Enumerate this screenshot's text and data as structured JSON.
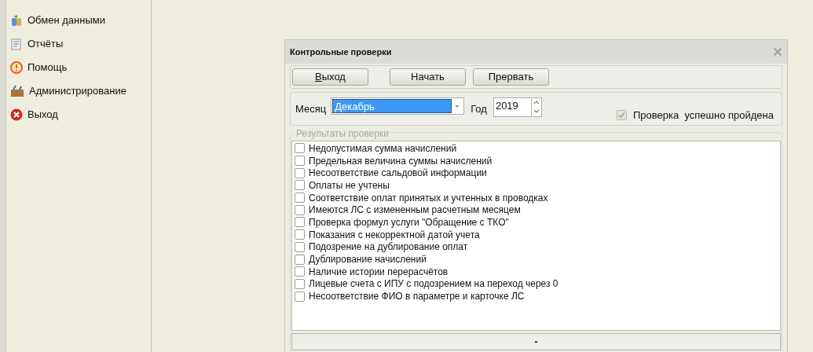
{
  "sidebar": {
    "items": [
      {
        "label": "Обмен данными",
        "kind": "exchange"
      },
      {
        "label": "Отчёты",
        "kind": "reports"
      },
      {
        "label": "Помощь",
        "kind": "help"
      },
      {
        "label": "Администрирование",
        "kind": "admin"
      },
      {
        "label": "Выход",
        "kind": "exit"
      }
    ]
  },
  "dialog": {
    "title": "Контрольные проверки",
    "buttons": [
      {
        "label": "Выход"
      },
      {
        "label": "Начать"
      },
      {
        "label": "Прервать"
      }
    ],
    "month": {
      "label": "Месяц",
      "value": "Декабрь"
    },
    "year": {
      "label": "Год",
      "value": "2019"
    },
    "passed": {
      "label": "Проверка  успешно пройдена",
      "checked": true,
      "disabled": true
    },
    "results": {
      "legend": "Результаты проверки",
      "items": [
        {
          "label": "Недопустимая сумма начислений",
          "checked": false
        },
        {
          "label": "Предельная величина суммы начислений",
          "checked": false
        },
        {
          "label": "Несоответствие сальдовой информации",
          "checked": false
        },
        {
          "label": "Оплаты не учтены",
          "checked": false
        },
        {
          "label": "Соответствие оплат принятых и учтенных в проводках",
          "checked": false
        },
        {
          "label": "Имеются ЛС с измененным расчетным месяцем",
          "checked": false
        },
        {
          "label": "Проверка формул услуги \"Обращение с ТКО\"",
          "checked": false
        },
        {
          "label": "Показания с некорректной датой учета",
          "checked": false
        },
        {
          "label": "Подозрение на дублирование оплат",
          "checked": false
        },
        {
          "label": "Дублирование начислений",
          "checked": false
        },
        {
          "label": "Наличие истории перерасчётов",
          "checked": false
        },
        {
          "label": "Лицевые счета с ИПУ с подозрением на переход через 0",
          "checked": false
        },
        {
          "label": "Несоответствие ФИО в параметре и карточке ЛС",
          "checked": false
        }
      ]
    },
    "status": "-"
  }
}
